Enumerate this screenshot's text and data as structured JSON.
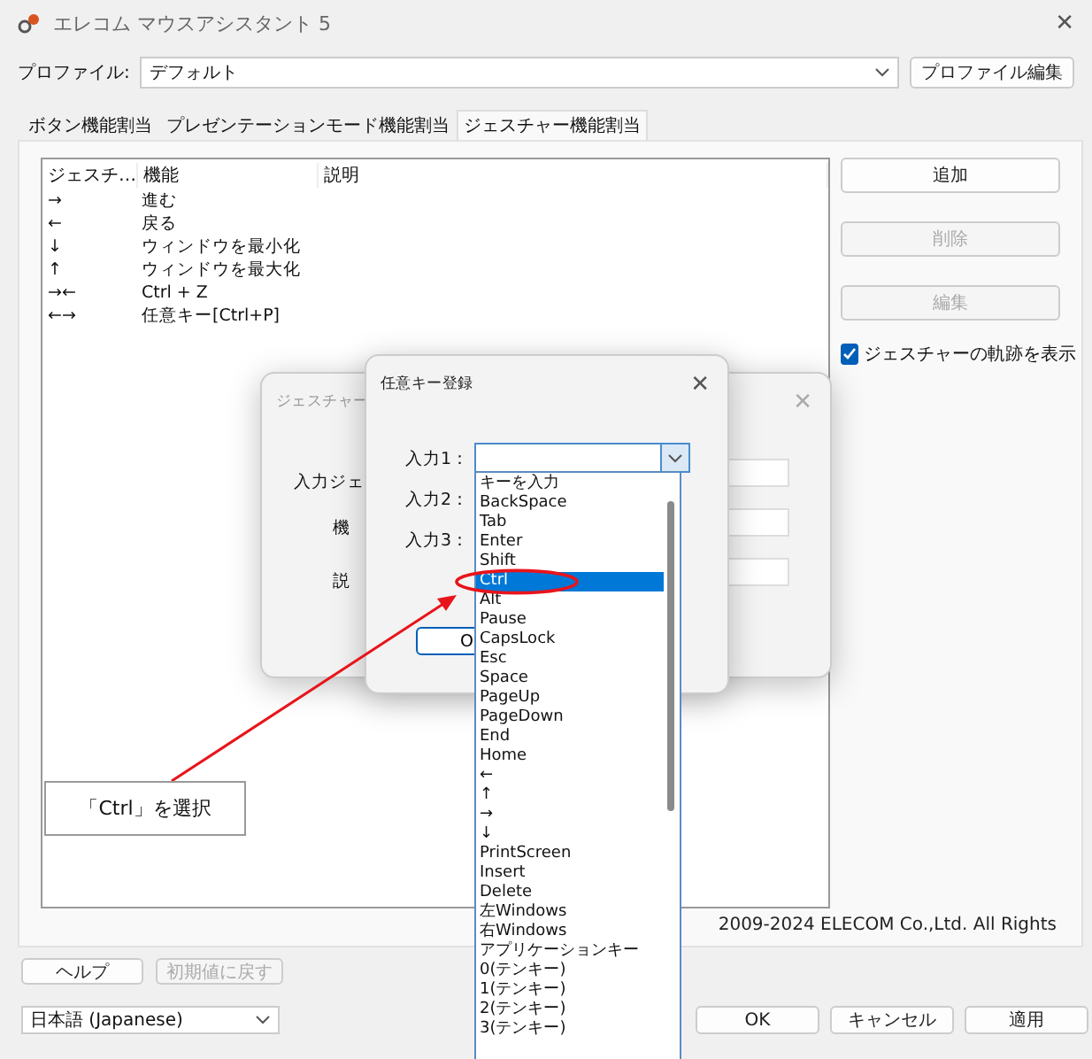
{
  "window": {
    "title": "エレコム マウスアシスタント 5",
    "close": "✕"
  },
  "profile": {
    "label": "プロファイル:",
    "value": "デフォルト",
    "edit_button": "プロファイル編集"
  },
  "tabs": [
    {
      "label": "ボタン機能割当",
      "selected": false
    },
    {
      "label": "プレゼンテーションモード機能割当",
      "selected": false
    },
    {
      "label": "ジェスチャー機能割当",
      "selected": true
    }
  ],
  "gesture_table": {
    "columns": [
      "ジェスチ…",
      "機能",
      "説明"
    ],
    "rows": [
      {
        "gesture": "→",
        "function": "進む"
      },
      {
        "gesture": "←",
        "function": "戻る"
      },
      {
        "gesture": "↓",
        "function": "ウィンドウを最小化"
      },
      {
        "gesture": "↑",
        "function": "ウィンドウを最大化"
      },
      {
        "gesture": "→←",
        "function": "Ctrl + Z"
      },
      {
        "gesture": "←→",
        "function": "任意キー[Ctrl+P]"
      }
    ]
  },
  "side_buttons": [
    {
      "label": "追加",
      "disabled": false
    },
    {
      "label": "削除",
      "disabled": true
    },
    {
      "label": "編集",
      "disabled": true
    }
  ],
  "show_trail": {
    "label": "ジェスチャーの軌跡を表示",
    "checked": true
  },
  "copyright": "2009-2024 ELECOM Co.,Ltd. All Rights",
  "bottom_buttons": [
    {
      "label": "ヘルプ",
      "disabled": false
    },
    {
      "label": "初期値に戻す",
      "disabled": true
    }
  ],
  "language": {
    "value": "日本語 (Japanese)"
  },
  "dialog_buttons": [
    {
      "label": "OK"
    },
    {
      "label": "キャンセル"
    },
    {
      "label": "適用"
    }
  ],
  "gesture_dialog": {
    "title": "ジェスチャー",
    "labels": [
      "入力ジェ",
      "機",
      "説"
    ],
    "close": "✕"
  },
  "key_dialog": {
    "title": "任意キー登録",
    "close": "✕",
    "button": "O",
    "inputs": [
      {
        "label": "入力1："
      },
      {
        "label": "入力2："
      },
      {
        "label": "入力3："
      }
    ],
    "options": [
      {
        "label": "キーを入力",
        "selected": false
      },
      {
        "label": "BackSpace",
        "selected": false
      },
      {
        "label": "Tab",
        "selected": false
      },
      {
        "label": "Enter",
        "selected": false
      },
      {
        "label": "Shift",
        "selected": false
      },
      {
        "label": "Ctrl",
        "selected": true
      },
      {
        "label": "Alt",
        "selected": false
      },
      {
        "label": "Pause",
        "selected": false
      },
      {
        "label": "CapsLock",
        "selected": false
      },
      {
        "label": "Esc",
        "selected": false
      },
      {
        "label": "Space",
        "selected": false
      },
      {
        "label": "PageUp",
        "selected": false
      },
      {
        "label": "PageDown",
        "selected": false
      },
      {
        "label": "End",
        "selected": false
      },
      {
        "label": "Home",
        "selected": false
      },
      {
        "label": "←",
        "selected": false
      },
      {
        "label": "↑",
        "selected": false
      },
      {
        "label": "→",
        "selected": false
      },
      {
        "label": "↓",
        "selected": false
      },
      {
        "label": "PrintScreen",
        "selected": false
      },
      {
        "label": "Insert",
        "selected": false
      },
      {
        "label": "Delete",
        "selected": false
      },
      {
        "label": "左Windows",
        "selected": false
      },
      {
        "label": "右Windows",
        "selected": false
      },
      {
        "label": "アプリケーションキー",
        "selected": false
      },
      {
        "label": "0(テンキー)",
        "selected": false
      },
      {
        "label": "1(テンキー)",
        "selected": false
      },
      {
        "label": "2(テンキー)",
        "selected": false
      },
      {
        "label": "3(テンキー)",
        "selected": false
      }
    ]
  },
  "annotation": {
    "text": "「Ctrl」を選択"
  }
}
